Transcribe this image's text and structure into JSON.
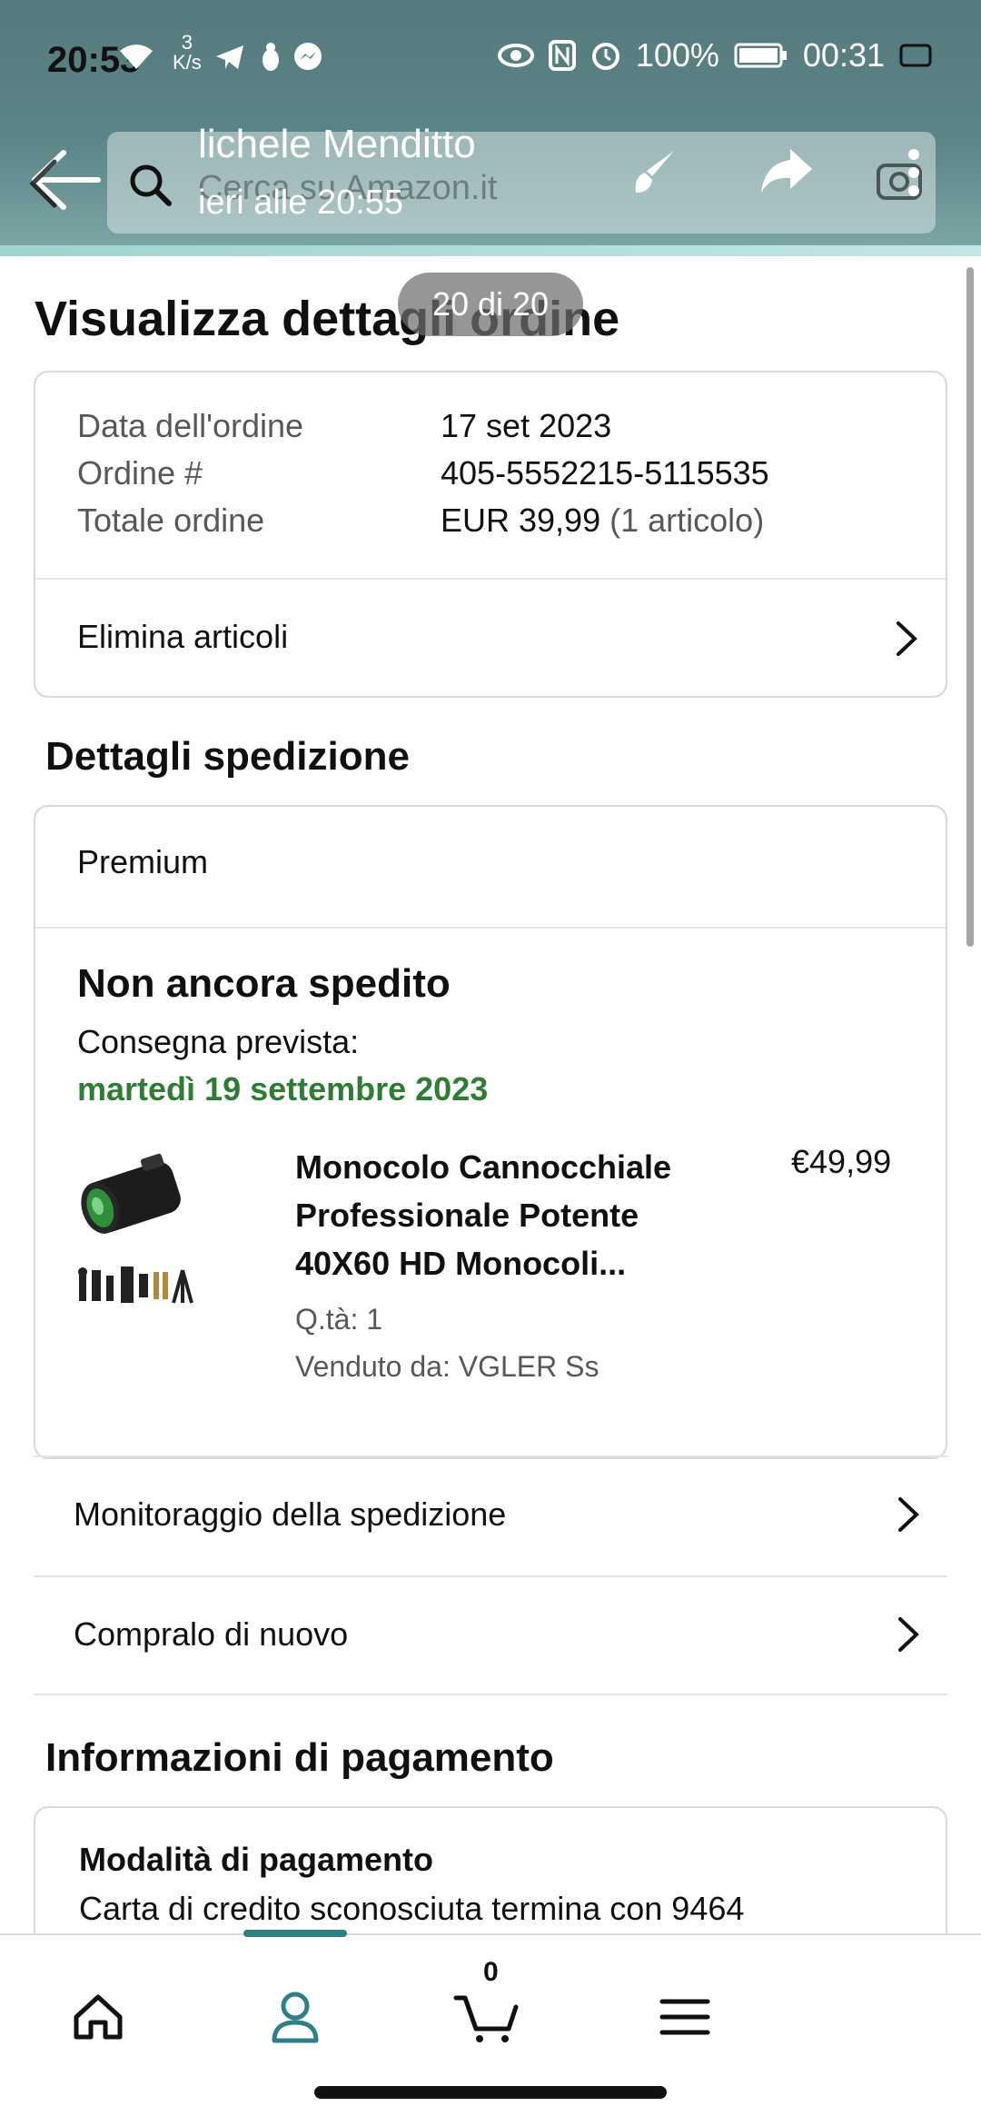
{
  "status_bar": {
    "time": "20:53",
    "net_speed_value": "3",
    "net_speed_unit": "K/s",
    "battery": "100%",
    "clock": "00:31"
  },
  "overlay": {
    "sender_name": "lichele Menditto",
    "sent_time": "ieri alle 20:55",
    "counter": "20 di 20"
  },
  "search": {
    "placeholder": "Cerca su Amazon.it"
  },
  "page": {
    "title": "Visualizza dettagli ordine"
  },
  "order_summary": {
    "date_label": "Data dell'ordine",
    "date_value": "17 set 2023",
    "number_label": "Ordine #",
    "number_value": "405-5552215-5115535",
    "total_label": "Totale ordine",
    "total_value": "EUR 39,99",
    "total_items": "(1 articolo)",
    "delete_items_label": "Elimina articoli"
  },
  "shipment": {
    "section_title": "Dettagli spedizione",
    "shipping_type": "Premium",
    "status": "Non ancora spedito",
    "eta_label": "Consegna prevista:",
    "eta_date": "martedì 19 settembre 2023",
    "product": {
      "name": "Monocolo Cannocchiale Professionale Potente 40X60 HD Monocoli...",
      "price": "€49,99",
      "quantity": "Q.tà: 1",
      "seller": "Venduto da: VGLER Ss"
    }
  },
  "actions": {
    "track_label": "Monitoraggio della spedizione",
    "buy_again_label": "Compralo di nuovo"
  },
  "payment": {
    "section_title": "Informazioni di pagamento",
    "method_title": "Modalità di pagamento",
    "method_desc": "Carta di credito sconosciuta  termina con 9464"
  },
  "bottom_nav": {
    "cart_count": "0"
  },
  "colors": {
    "accent_green": "#2e7d32",
    "nav_active": "#2f7f86"
  }
}
